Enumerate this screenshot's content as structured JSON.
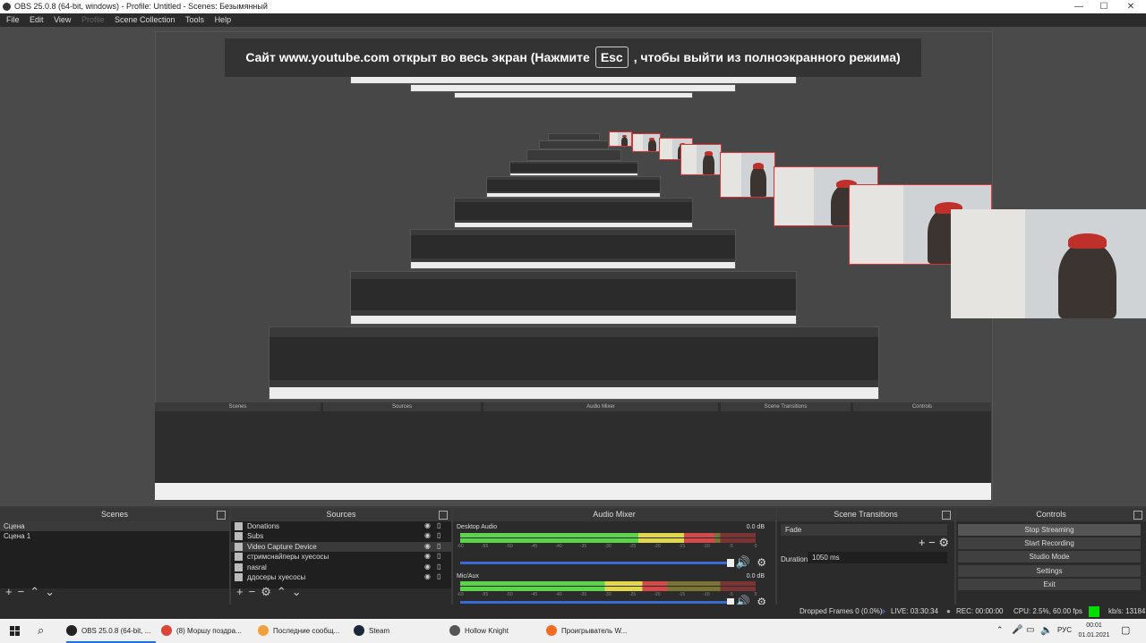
{
  "window": {
    "title": "OBS 25.0.8 (64-bit, windows) - Profile: Untitled - Scenes: Безымянный",
    "minimize": "—",
    "maximize": "☐",
    "close": "✕"
  },
  "menu": [
    "File",
    "Edit",
    "View",
    "Profile",
    "Scene Collection",
    "Tools",
    "Help"
  ],
  "fullscreen_notice": {
    "before": "Сайт www.youtube.com открыт во весь экран (Нажмите",
    "key": "Esc",
    "after": ", чтобы выйти из полноэкранного режима)"
  },
  "scenes": {
    "header": "Scenes",
    "items": [
      "Сцена",
      "Сцена 1"
    ]
  },
  "sources": {
    "header": "Sources",
    "items": [
      "Donations",
      "Subs",
      "Video Capture Device",
      "стримснайперы хуесосы",
      "nasral",
      "ддосеры хуесосы"
    ]
  },
  "audio_mixer": {
    "header": "Audio Mixer",
    "channels": [
      {
        "name": "Desktop Audio",
        "db": "0.0 dB",
        "level": 0.86
      },
      {
        "name": "Mic/Aux",
        "db": "0.0 dB",
        "level": 0.7
      }
    ],
    "ticks": [
      "-60",
      "-55",
      "-50",
      "-45",
      "-40",
      "-35",
      "-30",
      "-25",
      "-20",
      "-15",
      "-10",
      "-5",
      "0"
    ]
  },
  "transitions": {
    "header": "Scene Transitions",
    "selected": "Fade",
    "duration_label": "Duration",
    "duration_value": "1050 ms"
  },
  "controls": {
    "header": "Controls",
    "buttons": [
      "Stop Streaming",
      "Start Recording",
      "Studio Mode",
      "Settings",
      "Exit"
    ]
  },
  "status": {
    "dropped": "Dropped Frames 0 (0.0%)",
    "live": "LIVE: 03:30:34",
    "rec": "REC: 00:00:00",
    "cpu": "CPU: 2.5%, 60.00 fps",
    "kbps": "kb/s: 13184",
    "indicator_color": "#00dd00"
  },
  "taskbar": {
    "items": [
      {
        "label": "OBS 25.0.8 (64-bit, ...",
        "icon": "obs-icon",
        "color": "#222222"
      },
      {
        "label": "(8) Моршу поздра...",
        "icon": "chrome-icon",
        "color": "#db4437"
      },
      {
        "label": "Последние сообщ...",
        "icon": "donationalerts-icon",
        "color": "#f2a03d"
      },
      {
        "label": "Steam",
        "icon": "steam-icon",
        "color": "#1b2838"
      },
      {
        "label": "Hollow Knight",
        "icon": "hollow-knight-icon",
        "color": "#555555"
      },
      {
        "label": "Проигрыватель W...",
        "icon": "media-player-icon",
        "color": "#f26b21"
      }
    ],
    "language": "РУС",
    "time": "00:01",
    "date": "01.01.2021"
  }
}
